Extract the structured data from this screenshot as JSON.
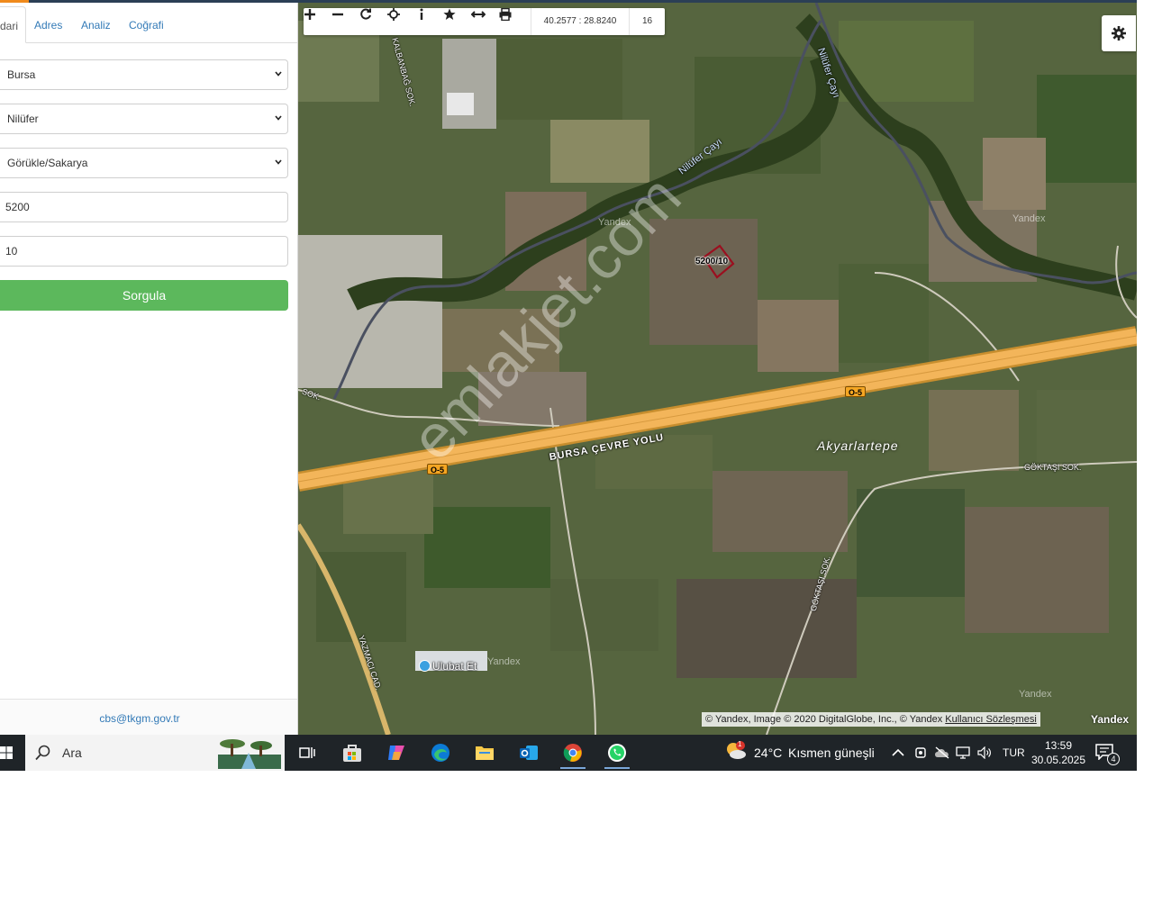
{
  "left_panel": {
    "tabs": [
      "dari",
      "Adres",
      "Analiz",
      "Coğrafi"
    ],
    "fields": {
      "province": "Bursa",
      "district": "Nilüfer",
      "neighborhood": "Görükle/Sakarya",
      "block": "5200",
      "parcel": "10"
    },
    "query_button": "Sorgula",
    "footer_email": "cbs@tkgm.gov.tr"
  },
  "map": {
    "coordinates": "40.2577 : 28.8240",
    "zoom": "16",
    "parcel_label": "5200/10",
    "labels": {
      "road_main": "BURSA ÇEVRE YOLU",
      "highway_badge": "O-5",
      "place": "Akyarlartepe",
      "river_1": "Nilüfer Çayı",
      "river_2": "Nilüfer Çayı",
      "street_goktasi": "GÖKTAŞI SOK.",
      "street_goktasi_2": "GÖKTAŞI SOK.",
      "street_kalbanbag": "KALBANBAĞ SOK.",
      "street_yazmaci": "YAZMACI CAD.",
      "street_sok_left": "SOK.",
      "poi": "Ulubat Et",
      "yandex_watermark": "Yandex"
    },
    "watermark": "emlakjet.com",
    "attribution_prefix": "© Yandex, Image © 2020 DigitalGlobe, Inc., © Yandex",
    "attribution_link": "Kullanıcı Sözleşmesi",
    "brand": "Yandex"
  },
  "taskbar": {
    "search_label": "Ara",
    "weather_temp": "24°C",
    "weather_desc": "Kısmen güneşli",
    "weather_badge": "1",
    "language": "TUR",
    "time": "13:59",
    "date": "30.05.2025",
    "notification_count": "4",
    "icons": [
      "task-view-icon",
      "store-icon",
      "copilot-icon",
      "edge-icon",
      "file-explorer-icon",
      "outlook-icon",
      "chrome-icon",
      "whatsapp-icon"
    ]
  },
  "colors": {
    "accent_green": "#5cb85c",
    "link_blue": "#337ab7",
    "highway": "#f3b55a",
    "parcel_outline": "#9b0f1f",
    "taskbar": "#1f2428"
  }
}
